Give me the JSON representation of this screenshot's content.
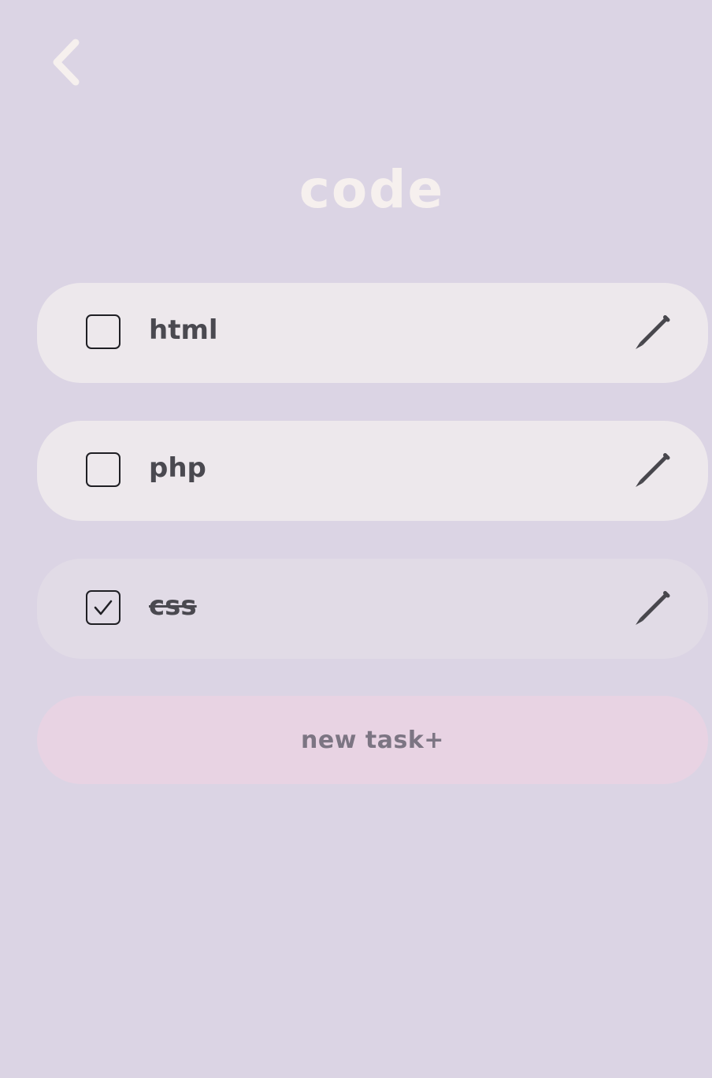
{
  "header": {
    "back_icon": "chevron-left-icon",
    "title": "code"
  },
  "tasks": [
    {
      "label": "html",
      "checked": false,
      "edit_icon": "pencil-icon"
    },
    {
      "label": "php",
      "checked": false,
      "edit_icon": "pencil-icon"
    },
    {
      "label": "css",
      "checked": true,
      "edit_icon": "pencil-icon"
    }
  ],
  "actions": {
    "new_task_label": "new task+"
  },
  "colors": {
    "background": "#dbd4e4",
    "title": "#f6f0ee",
    "task_row": "#ede8ec",
    "task_row_done": "#e1dbe6",
    "new_task_button": "#e8d3e3",
    "text": "#4a4950"
  }
}
